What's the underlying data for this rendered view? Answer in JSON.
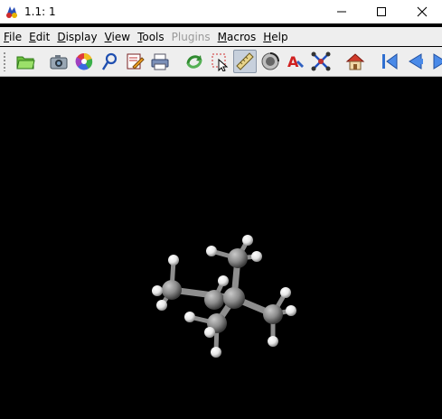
{
  "window": {
    "title": "1.1: 1"
  },
  "menu": [
    {
      "mnemonic": "F",
      "rest": "ile",
      "enabled": true
    },
    {
      "mnemonic": "E",
      "rest": "dit",
      "enabled": true
    },
    {
      "mnemonic": "D",
      "rest": "isplay",
      "enabled": true
    },
    {
      "mnemonic": "V",
      "rest": "iew",
      "enabled": true
    },
    {
      "mnemonic": "T",
      "rest": "ools",
      "enabled": true
    },
    {
      "mnemonic": "",
      "rest": "Plugins",
      "enabled": false
    },
    {
      "mnemonic": "M",
      "rest": "acros",
      "enabled": true
    },
    {
      "mnemonic": "H",
      "rest": "elp",
      "enabled": true
    }
  ],
  "toolbar": {
    "buttons": [
      {
        "icon": "open-folder-icon"
      },
      {
        "icon": "camera-icon"
      },
      {
        "icon": "color-wheel-icon"
      },
      {
        "icon": "pipette-icon"
      },
      {
        "icon": "edit-document-icon"
      },
      {
        "icon": "print-icon"
      },
      {
        "icon": "rotate-icon"
      },
      {
        "icon": "select-icon"
      },
      {
        "icon": "ruler-icon"
      },
      {
        "icon": "spin-icon"
      },
      {
        "icon": "label-text-icon"
      },
      {
        "icon": "move-molecule-icon"
      },
      {
        "icon": "home-icon"
      },
      {
        "icon": "first-frame-icon"
      },
      {
        "icon": "previous-frame-icon"
      },
      {
        "icon": "next-frame-icon"
      }
    ],
    "pressed": [
      "ruler-icon"
    ]
  },
  "molecule": {
    "name": "",
    "atoms": [
      {
        "element": "C",
        "role": "central"
      },
      {
        "element": "C",
        "role": "methyl-top"
      },
      {
        "element": "C",
        "role": "methyl-left"
      },
      {
        "element": "C",
        "role": "methyl-right"
      },
      {
        "element": "C",
        "role": "methyl-front"
      }
    ],
    "carbon_color": "#8c8c8c",
    "hydrogen_color": "#f2f2f2",
    "background_color": "#000000"
  }
}
